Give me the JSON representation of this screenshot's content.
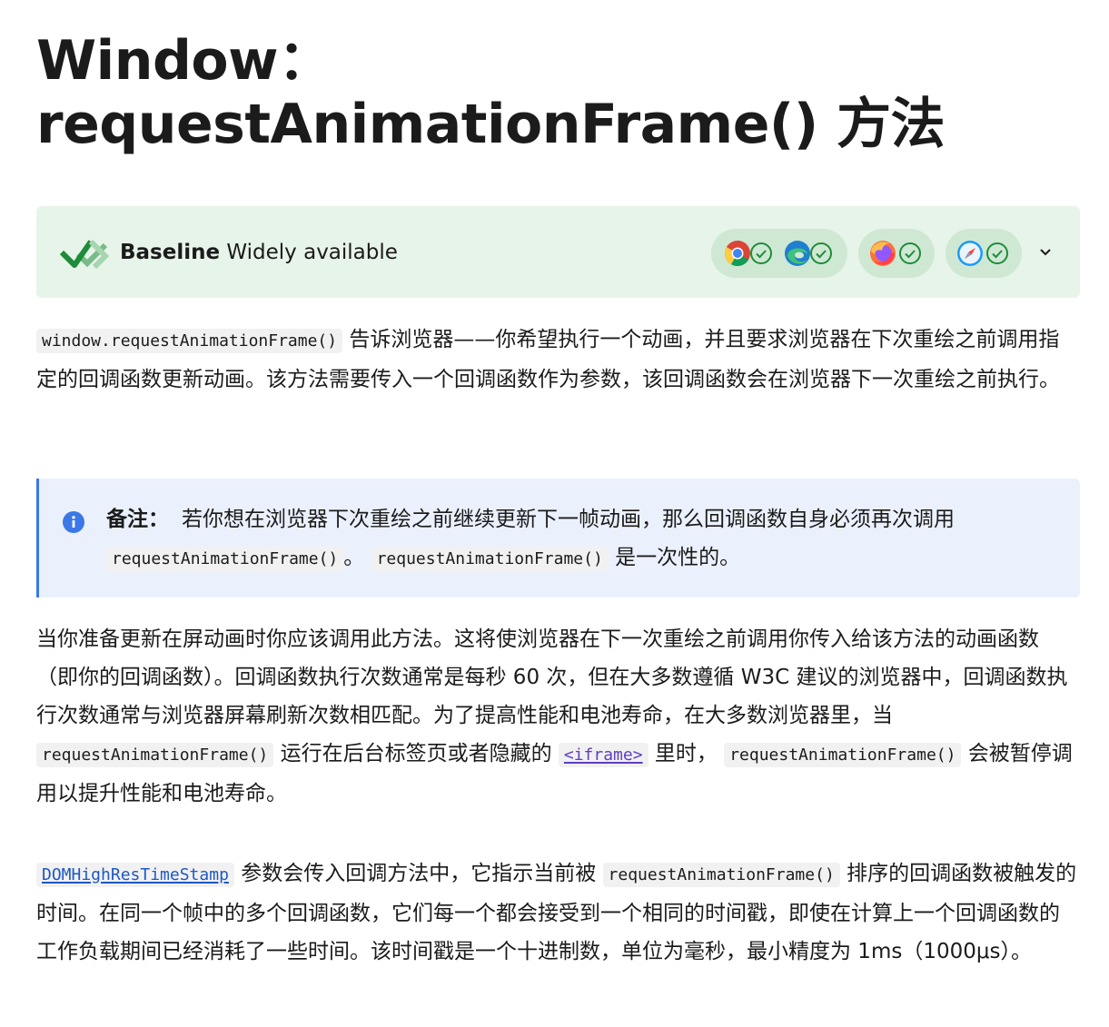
{
  "title": "Window：requestAnimationFrame() 方法",
  "baseline": {
    "label_bold": "Baseline",
    "label_rest": "Widely available",
    "browsers": [
      "chrome-icon",
      "edge-icon",
      "firefox-icon",
      "safari-icon"
    ],
    "colors": {
      "background": "#e7f4e9",
      "pill": "#cfe8d3",
      "check": "#1e8c3a"
    }
  },
  "intro": {
    "code": "window.requestAnimationFrame()",
    "text": "告诉浏览器——你希望执行一个动画，并且要求浏览器在下次重绘之前调用指定的回调函数更新动画。该方法需要传入一个回调函数作为参数，该回调函数会在浏览器下一次重绘之前执行。"
  },
  "note": {
    "label": "备注：",
    "text1": "若你想在浏览器下次重绘之前继续更新下一帧动画，那么回调函数自身必须再次调用",
    "code1": "requestAnimationFrame()",
    "text2": "。",
    "code2": "requestAnimationFrame()",
    "text3": "是一次性的。"
  },
  "para2": {
    "text1": "当你准备更新在屏动画时你应该调用此方法。这将使浏览器在下一次重绘之前调用你传入给该方法的动画函数（即你的回调函数）。回调函数执行次数通常是每秒 60 次，但在大多数遵循 W3C 建议的浏览器中，回调函数执行次数通常与浏览器屏幕刷新次数相匹配。为了提高性能和电池寿命，在大多数浏览器里，当",
    "code1": "requestAnimationFrame()",
    "text2": "运行在后台标签页或者隐藏的",
    "link_code": "<iframe>",
    "text3": "里时，",
    "code2": "requestAnimationFrame()",
    "text4": "会被暂停调用以提升性能和电池寿命。"
  },
  "para3": {
    "link_code": "DOMHighResTimeStamp",
    "text1": "参数会传入回调方法中，它指示当前被",
    "code1": "requestAnimationFrame()",
    "text2": "排序的回调函数被触发的时间。在同一个帧中的多个回调函数，它们每一个都会接受到一个相同的时间戳，即使在计算上一个回调函数的工作负载期间已经消耗了一些时间。该时间戳是一个十进制数，单位为毫秒，最小精度为 1ms（1000μs）。"
  }
}
